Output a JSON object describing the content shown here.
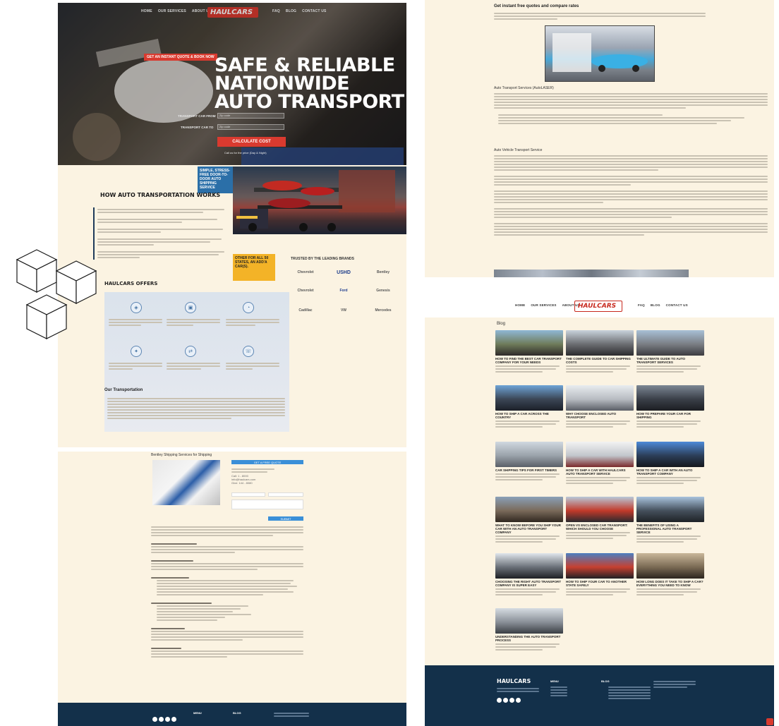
{
  "hero": {
    "nav_left": [
      "HOME",
      "OUR SERVICES",
      "ABOUT US"
    ],
    "nav_right": [
      "FAQ",
      "BLOG",
      "CONTACT US"
    ],
    "logo": "HAULCARS",
    "badge": "GET AN INSTANT QUOTE & BOOK NOW",
    "title_line1": "SAFE & RELIABLE",
    "title_line2": "NATIONWIDE",
    "title_line3": "AUTO TRANSPORT",
    "pickup_label": "TRANSPORT CAR FROM",
    "dropoff_label": "TRANSPORT CAR TO",
    "pickup_placeholder": "Zip code",
    "dropoff_placeholder": "Zip code",
    "cta": "CALCULATE COST",
    "note": "Call us for the price (Day & Night)"
  },
  "how": {
    "title": "HOW AUTO TRANSPORTATION WORKS",
    "blue_box": "SIMPLE, STRESS-FREE DOOR-TO-DOOR AUTO SHIPPING SERVICE",
    "yellow_box": "OTHER FOR ALL 50 STATES, AN ADD'A CAR(S).",
    "brands_title": "TRUSTED BY THE LEADING BRANDS",
    "brands": [
      "Chevrolet",
      "USHD",
      "Bentley",
      "Chevrolet",
      "Ford",
      "Genesis",
      "Cadillac",
      "VW",
      "Mercedes"
    ]
  },
  "offers": {
    "title": "HAULCARS OFFERS"
  },
  "our_transportation": {
    "title": "Our Transportation"
  },
  "article": {
    "title": "Bentley Shipping Services for Shipping",
    "form_header": "GET A FREE QUOTE",
    "contact_lines": [
      "Call: 1 - 8000",
      "info@haulcars.com",
      "Give: 144 - 8080"
    ],
    "submit": "SUBMIT"
  },
  "right_top": {
    "title": "Get instant free quotes and compare rates",
    "section1": "Auto Transport Services (AutoLASER)",
    "section2": "Auto Vehicle Transport Service"
  },
  "blog": {
    "nav_left": [
      "HOME",
      "OUR SERVICES",
      "ABOUT US"
    ],
    "nav_right": [
      "FAQ",
      "BLOG",
      "CONTACT US"
    ],
    "logo": "HAULCARS",
    "title": "Blog",
    "posts": [
      "HOW TO FIND THE BEST CAR TRANSPORT COMPANY FOR YOUR NEEDS",
      "THE COMPLETE GUIDE TO CAR SHIPPING COSTS",
      "THE ULTIMATE GUIDE TO AUTO TRANSPORT SERVICES",
      "HOW TO SHIP A CAR ACROSS THE COUNTRY",
      "WHY CHOOSE ENCLOSED AUTO TRANSPORT",
      "HOW TO PREPARE YOUR CAR FOR SHIPPING",
      "CAR SHIPPING TIPS FOR FIRST TIMERS",
      "HOW TO SHIP A CAR WITH HAULCARS AUTO TRANSPORT SERVICE",
      "HOW TO SHIP A CAR WITH AN AUTO TRANSPORT COMPANY",
      "WHAT TO KNOW BEFORE YOU SHIP YOUR CAR WITH AN AUTO TRANSPORT COMPANY",
      "OPEN VS ENCLOSED CAR TRANSPORT: WHICH SHOULD YOU CHOOSE",
      "THE BENEFITS OF USING A PROFESSIONAL AUTO TRANSPORT SERVICE",
      "CHOOSING THE RIGHT AUTO TRANSPORT COMPANY IS SUPER EASY",
      "HOW TO SHIP YOUR CAR TO ANOTHER STATE SAFELY",
      "HOW LONG DOES IT TAKE TO SHIP A CAR? EVERYTHING YOU NEED TO KNOW",
      "UNDERSTANDING THE AUTO TRANSPORT PROCESS"
    ],
    "footer_logo": "HAULCARS",
    "footer_cols": [
      "MENU",
      "BLOG"
    ]
  },
  "footer_left": {
    "cols": [
      "MENU",
      "BLOG"
    ]
  },
  "colors": {
    "brand_red": "#d93a2f",
    "navy": "#13304a",
    "cream": "#fbf3e2",
    "accent_blue": "#2b6fa8",
    "accent_yellow": "#f3b327"
  }
}
